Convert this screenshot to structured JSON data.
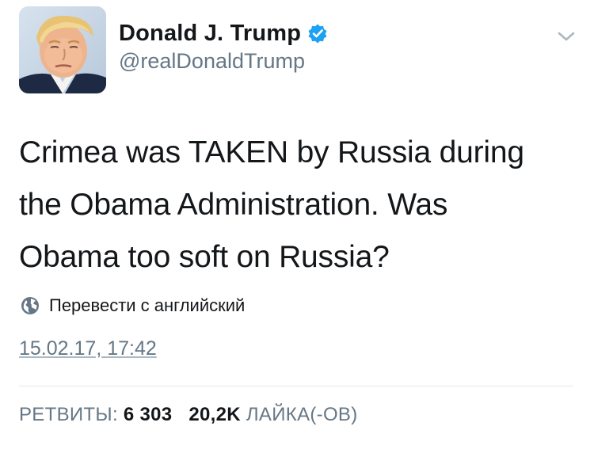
{
  "author": {
    "display_name": "Donald J. Trump",
    "handle": "@realDonaldTrump",
    "verified": true
  },
  "menu": {
    "icon": "chevron-down-icon"
  },
  "tweet": {
    "lines": [
      "Crimea was TAKEN by Russia during",
      "the Obama Administration. Was",
      "Obama too soft on Russia?"
    ]
  },
  "translate": {
    "icon": "globe-icon",
    "label": "Перевести с английский"
  },
  "timestamp": "15.02.17, 17:42",
  "stats": {
    "retweets_label": "РЕТВИТЫ:",
    "retweets_count": "6 303",
    "likes_count": "20,2K",
    "likes_label": "ЛАЙКА(-ОВ)"
  },
  "colors": {
    "text_primary": "#14171a",
    "text_secondary": "#657786",
    "verified_blue": "#1da1f2",
    "divider": "#e1e8ed"
  }
}
